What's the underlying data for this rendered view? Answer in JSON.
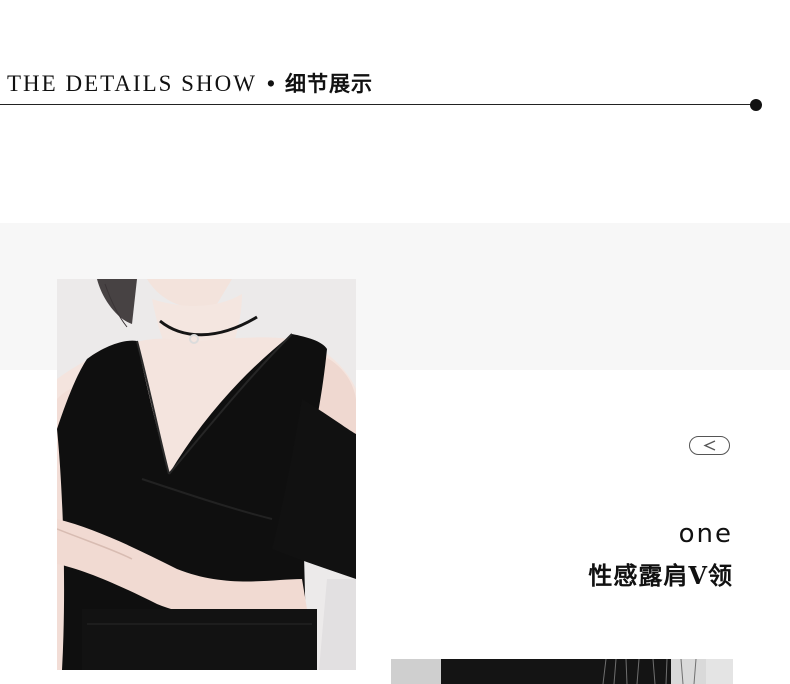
{
  "header": {
    "title_en": "THE DETAILS SHOW",
    "bullet": "•",
    "title_cn": "细节展示"
  },
  "feature": {
    "number": "one",
    "title": "性感露肩V领"
  },
  "images": {
    "main_photo": "model-black-cold-shoulder-v-neck-dress",
    "secondary_photo": "dress-detail-partial"
  },
  "icons": {
    "prev": "chevron-left-icon"
  },
  "colors": {
    "text": "#111111",
    "band": "#f7f7f7",
    "dress": "#0e0e0e",
    "skin": "#f4e6e0"
  }
}
